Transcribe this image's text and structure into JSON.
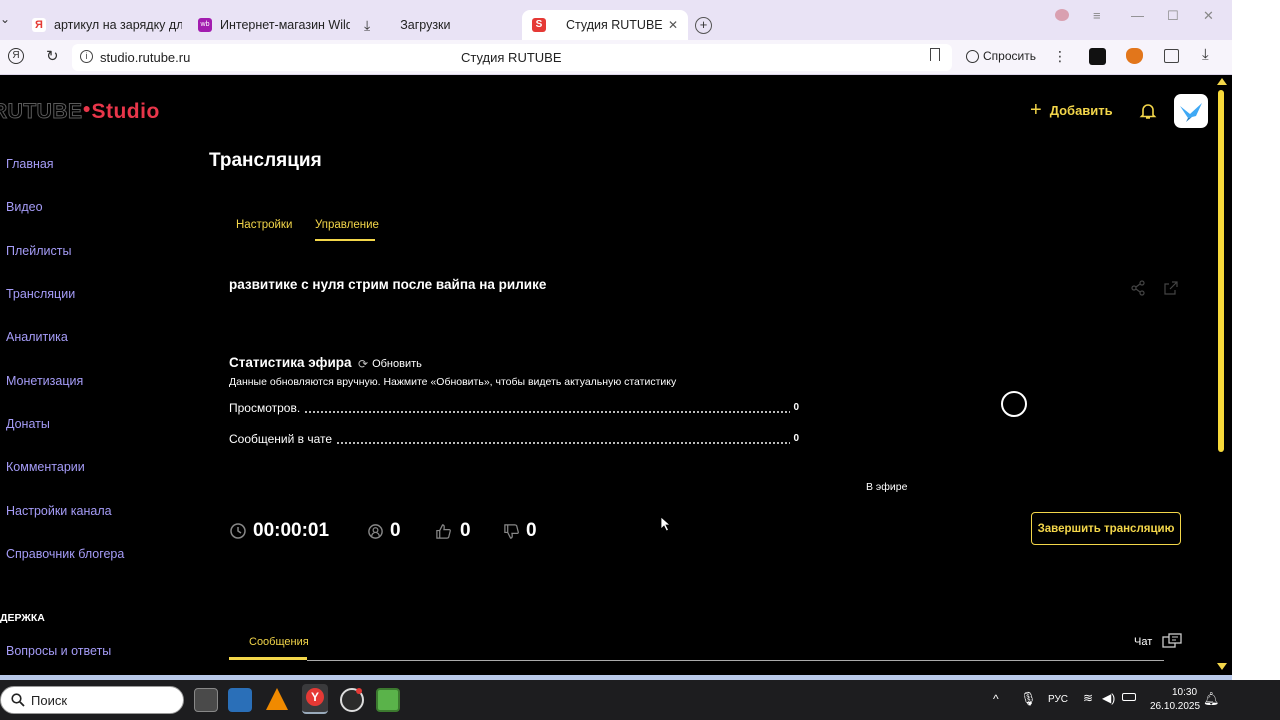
{
  "browser": {
    "tabs": [
      {
        "label": "артикул на зарядку для м",
        "favicon_color": "#e53935",
        "favicon_char": "Я"
      },
      {
        "label": "Интернет-магазин Wildb",
        "favicon_color": "#a21caf",
        "favicon_char": "wb"
      },
      {
        "label": "Загрузки",
        "favicon_color": "",
        "favicon_char": "⤓"
      },
      {
        "label": "Студия RUTUBE",
        "favicon_color": "#e53935",
        "favicon_char": "S"
      }
    ],
    "new_tab": "+",
    "url": "studio.rutube.ru",
    "page_title": "Студия RUTUBE",
    "ask_label": "Спросить"
  },
  "app": {
    "logo_main": "RUTUBE",
    "logo_accent": "Studio",
    "header": {
      "add_label": "Добавить"
    },
    "sidebar": {
      "items": [
        {
          "label": "Главная"
        },
        {
          "label": "Видео"
        },
        {
          "label": "Плейлисты"
        },
        {
          "label": "Трансляции"
        },
        {
          "label": "Аналитика"
        },
        {
          "label": "Монетизация"
        },
        {
          "label": "Донаты"
        },
        {
          "label": "Комментарии"
        },
        {
          "label": "Настройки канала"
        },
        {
          "label": "Справочник блогера"
        }
      ],
      "section_label": "ДЕРЖКА",
      "faq_label": "Вопросы и ответы"
    },
    "page_title": "Трансляция",
    "tabs": [
      {
        "label": "Настройки"
      },
      {
        "label": "Управление"
      }
    ],
    "stream_title": "развитике с нуля стрим после вайпа на рилике",
    "stats": {
      "title": "Статистика эфира",
      "refresh_label": "Обновить",
      "hint": "Данные обновляются вручную. Нажмите «Обновить», чтобы видеть актуальную статистику",
      "rows": [
        {
          "label": "Просмотров.",
          "value": "0"
        },
        {
          "label": "Сообщений в чате",
          "value": "0"
        }
      ]
    },
    "live_label": "В эфире",
    "live_counters": {
      "duration": "00:00:01",
      "viewers": "0",
      "likes": "0",
      "dislikes": "0"
    },
    "end_button": "Завершить трансляцию",
    "bottom_tabs": {
      "messages": "Сообщения",
      "chat": "Чат"
    }
  },
  "taskbar": {
    "search_label": "Поиск",
    "lang": "РУС",
    "time": "10:30",
    "date": "26.10.2025"
  },
  "colors": {
    "accent_yellow": "#f3d64a",
    "nav_purple": "#a59cf7",
    "logo_red": "#e8364a"
  }
}
